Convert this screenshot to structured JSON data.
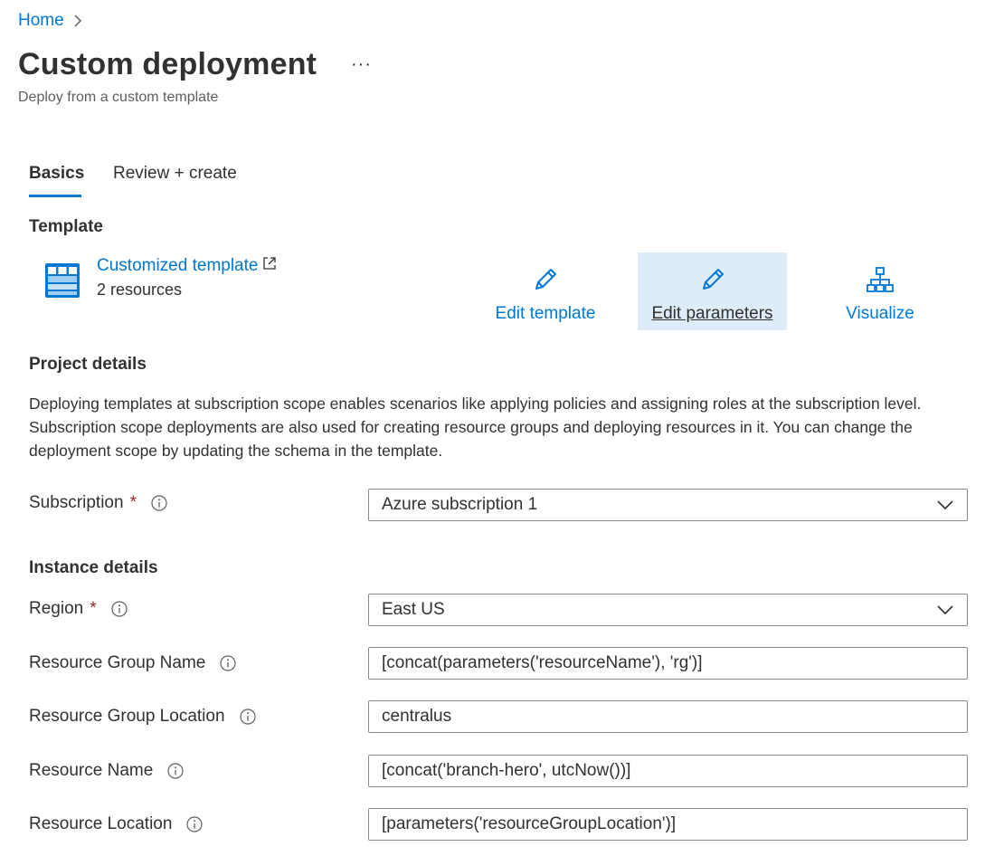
{
  "breadcrumb": {
    "home": "Home"
  },
  "header": {
    "title": "Custom deployment",
    "more": "···",
    "subtitle": "Deploy from a custom template"
  },
  "tabs": [
    {
      "label": "Basics",
      "active": true
    },
    {
      "label": "Review + create",
      "active": false
    }
  ],
  "template": {
    "heading": "Template",
    "link": "Customized template",
    "resources": "2 resources",
    "actions": {
      "edit_template": "Edit template",
      "edit_parameters": "Edit parameters",
      "visualize": "Visualize"
    }
  },
  "project": {
    "heading": "Project details",
    "description": "Deploying templates at subscription scope enables scenarios like applying policies and assigning roles at the subscription level. Subscription scope deployments are also used for creating resource groups and deploying resources in it. You can change the deployment scope by updating the schema in the template.",
    "subscription_label": "Subscription",
    "subscription_value": "Azure subscription 1"
  },
  "instance": {
    "heading": "Instance details",
    "region_label": "Region",
    "region_value": "East US",
    "rg_name_label": "Resource Group Name",
    "rg_name_value": "[concat(parameters('resourceName'), 'rg')]",
    "rg_location_label": "Resource Group Location",
    "rg_location_value": "centralus",
    "resource_name_label": "Resource Name",
    "resource_name_value": "[concat('branch-hero', utcNow())]",
    "resource_location_label": "Resource Location",
    "resource_location_value": "[parameters('resourceGroupLocation')]"
  },
  "required_marker": "*",
  "colors": {
    "accent": "#0078d4",
    "selected_bg": "#deecf9",
    "required": "#a4262c"
  }
}
